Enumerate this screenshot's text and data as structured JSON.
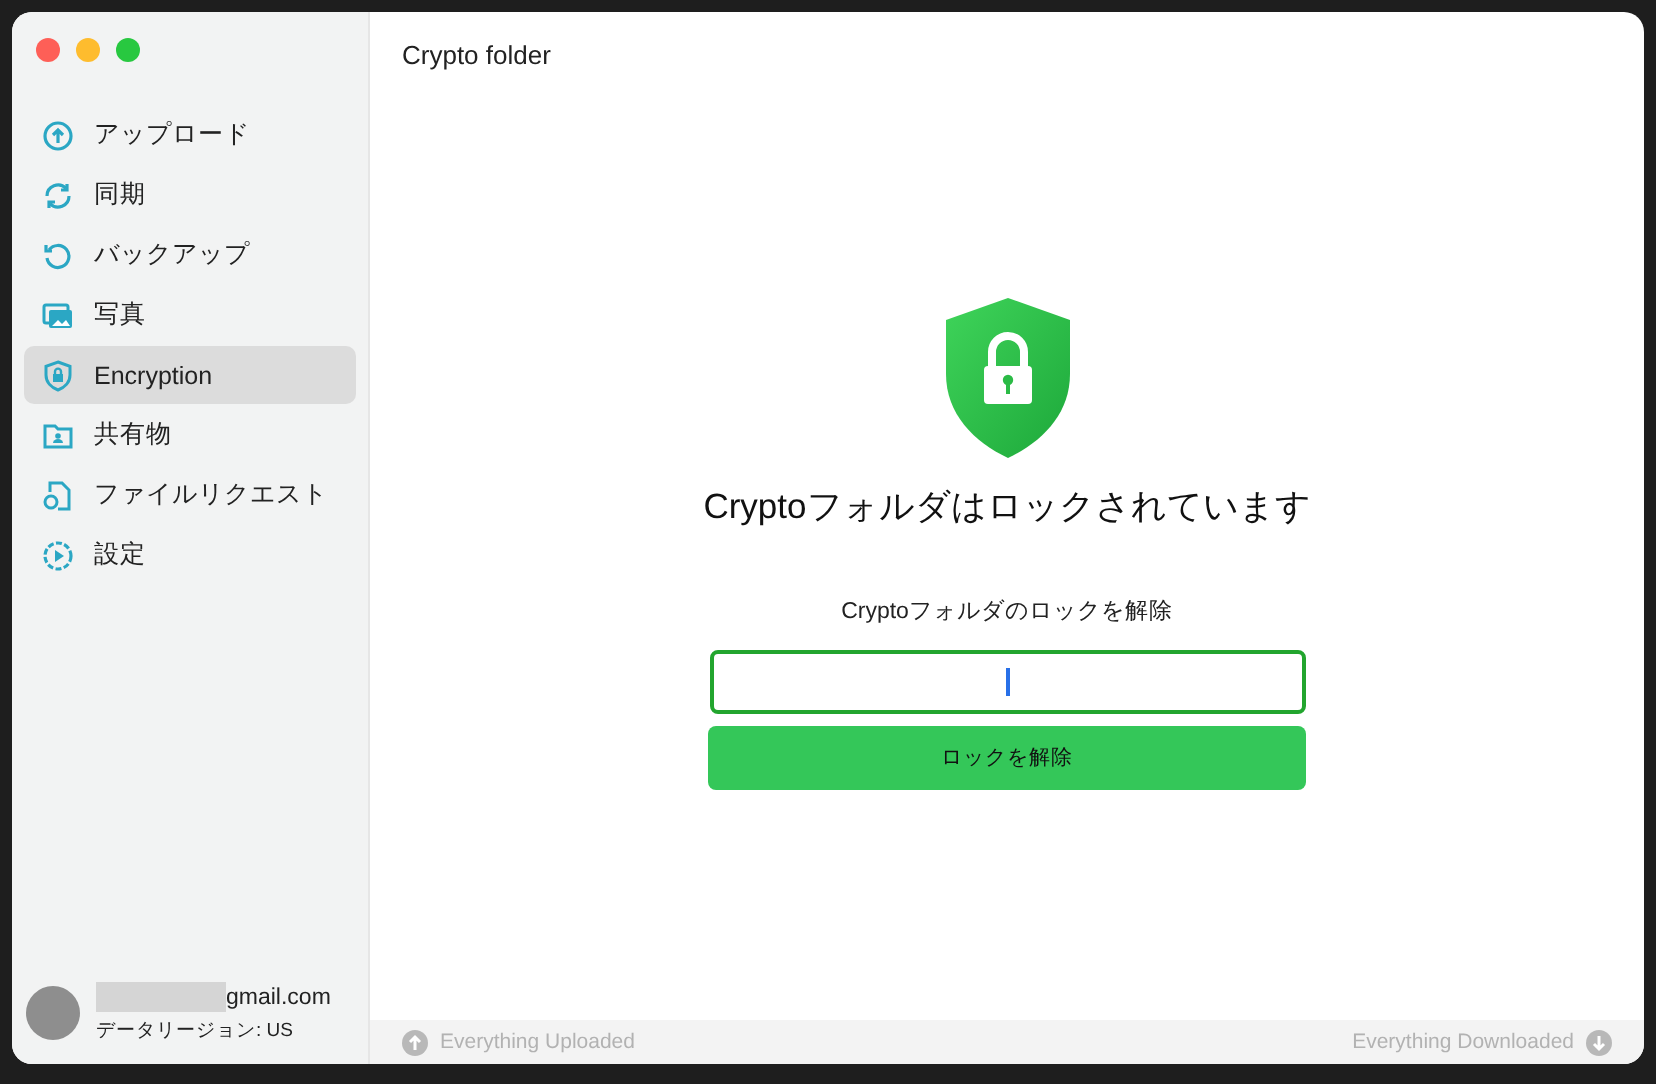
{
  "sidebar": {
    "items": [
      {
        "label": "アップロード",
        "selected": false
      },
      {
        "label": "同期",
        "selected": false
      },
      {
        "label": "バックアップ",
        "selected": false
      },
      {
        "label": "写真",
        "selected": false
      },
      {
        "label": "Encryption",
        "selected": true
      },
      {
        "label": "共有物",
        "selected": false
      },
      {
        "label": "ファイルリクエスト",
        "selected": false
      },
      {
        "label": "設定",
        "selected": false
      }
    ],
    "account": {
      "email": "gmail.com",
      "region": "データリージョン: US"
    }
  },
  "main": {
    "title": "Crypto folder",
    "heading": "Cryptoフォルダはロックされています",
    "prompt": "Cryptoフォルダのロックを解除",
    "button": "ロックを解除"
  },
  "status_bar": {
    "left": "Everything Uploaded",
    "right": "Everything Downloaded"
  }
}
